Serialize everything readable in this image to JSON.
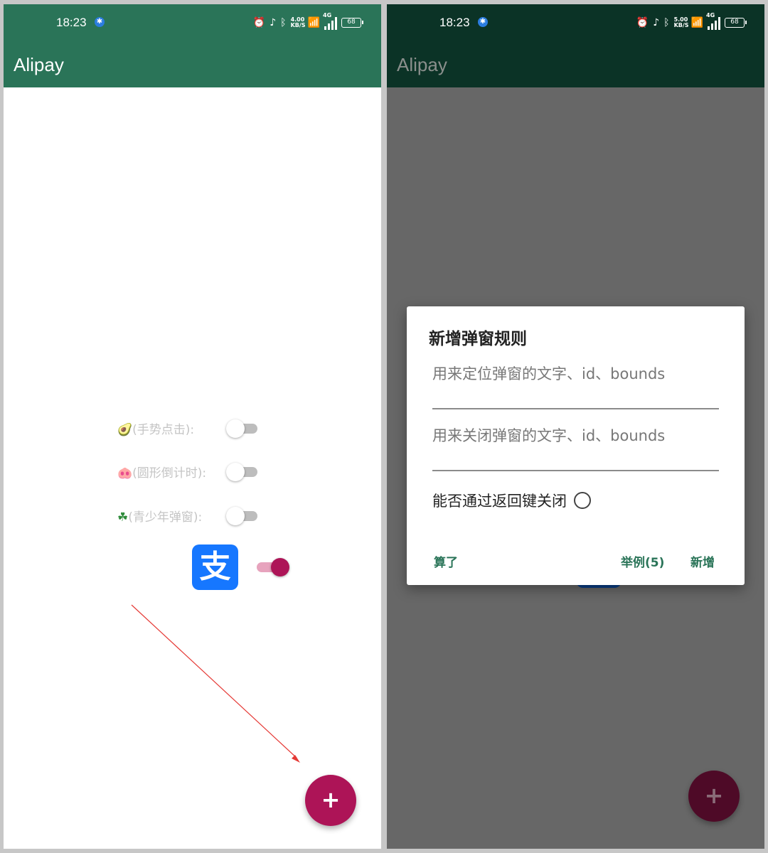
{
  "status": {
    "time": "18:23",
    "net_speed_left": "4.00",
    "net_speed_right": "5.00",
    "net_unit": "KB/S",
    "network_type": "4G",
    "battery": "68",
    "icons": [
      "alarm-icon",
      "music-mute-icon",
      "bluetooth-icon",
      "wifi-icon",
      "signal-icon",
      "battery-icon"
    ]
  },
  "app": {
    "title": "Alipay",
    "accent": "#ad1457",
    "toolbar_color": "#2a7458"
  },
  "rules": [
    {
      "emoji": "🥑",
      "label": "(手势点击):",
      "enabled": false
    },
    {
      "emoji": "🐽",
      "label": "(圆形倒计时):",
      "enabled": false
    },
    {
      "emoji": "☘",
      "label": "(青少年弹窗):",
      "enabled": false
    }
  ],
  "alipay_icon_glyph": "支",
  "alipay_enabled": true,
  "fab_label": "+",
  "dialog": {
    "title": "新增弹窗规则",
    "field1_placeholder": "用来定位弹窗的文字、id、bounds",
    "field2_placeholder": "用来关闭弹窗的文字、id、bounds",
    "checkbox_label": "能否通过返回键关闭",
    "cancel": "算了",
    "example": "举例(5)",
    "add": "新增"
  }
}
